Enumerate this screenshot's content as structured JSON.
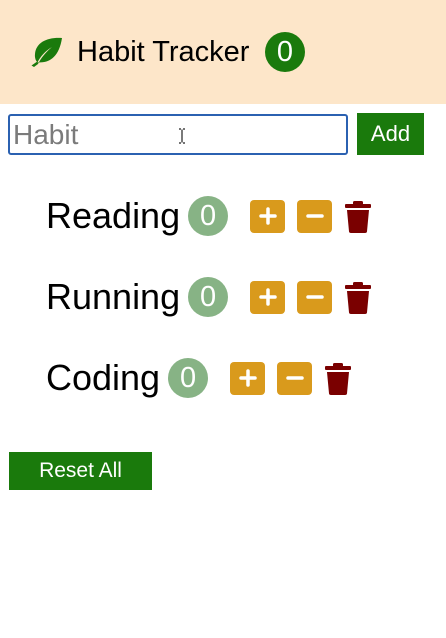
{
  "header": {
    "logo_icon": "leaf-icon",
    "title": "Habit Tracker",
    "total_count": "0"
  },
  "form": {
    "input_placeholder": "Habit",
    "input_value": "",
    "add_label": "Add"
  },
  "habits": [
    {
      "name": "Reading",
      "count": "0"
    },
    {
      "name": "Running",
      "count": "0"
    },
    {
      "name": "Coding",
      "count": "0"
    }
  ],
  "reset_label": "Reset All",
  "colors": {
    "header_bg": "#fde6c9",
    "primary_green": "#1a7a0c",
    "count_badge": "#87b385",
    "action_orange": "#d99a1c",
    "trash_red": "#7a0000",
    "input_border": "#2b61b1"
  }
}
